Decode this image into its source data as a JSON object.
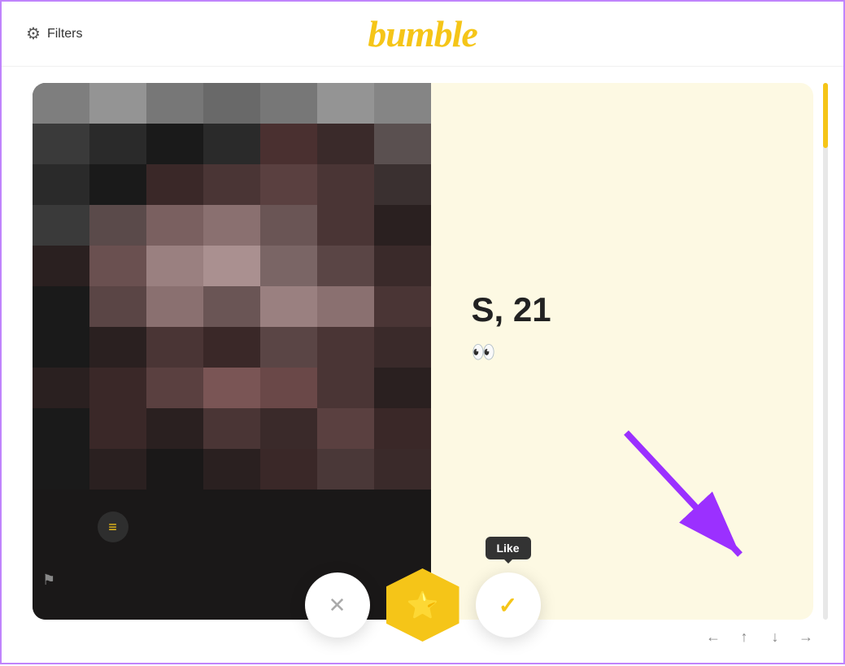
{
  "header": {
    "logo_text": "bumble",
    "filters_label": "Filters"
  },
  "profile": {
    "name": "S, 21",
    "eyes_icon": "👀"
  },
  "buttons": {
    "dislike_label": "✕",
    "superlike_label": "★",
    "like_label": "✓",
    "like_tooltip": "Like",
    "flag_label": "⚑"
  },
  "nav": {
    "left": "←",
    "up": "↑",
    "down": "↓",
    "right": "→"
  },
  "colors": {
    "accent": "#f5c518",
    "purple": "#9b30ff",
    "background_info": "#fdf9e3"
  }
}
